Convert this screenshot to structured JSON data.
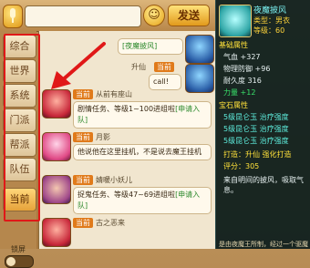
{
  "input": {
    "send_label": "发送",
    "emoji_label": "☺"
  },
  "tabs": [
    {
      "label": "综合"
    },
    {
      "label": "世界"
    },
    {
      "label": "系统"
    },
    {
      "label": "门派"
    },
    {
      "label": "帮派"
    },
    {
      "label": "队伍"
    },
    {
      "label": "当前"
    }
  ],
  "lock_label": "锁屏",
  "messages": [
    {
      "tag": "",
      "name": "",
      "text_prefix": "",
      "text_link": "[夜魔披风]",
      "text_suffix": ""
    },
    {
      "tag": "当前",
      "name": "升仙",
      "text_prefix": "call!",
      "text_link": "",
      "text_suffix": ""
    },
    {
      "tag": "当前",
      "name": "从前有座山",
      "text_prefix": "剧情任务、等级1~100进组啦",
      "text_link": "[申请入队]",
      "text_suffix": ""
    },
    {
      "tag": "当前",
      "name": "月影",
      "text_prefix": "他说他在这里挂机，不是说去魔王挂机",
      "text_link": "",
      "text_suffix": ""
    },
    {
      "tag": "当前",
      "name": "婧暖小妖儿",
      "text_prefix": "捉鬼任务、等级47~69进组啦",
      "text_link": "[申请入队]",
      "text_suffix": ""
    },
    {
      "tag": "当前",
      "name": "古之恶来",
      "text_prefix": "",
      "text_link": "",
      "text_suffix": ""
    }
  ],
  "tooltip": {
    "title": "夜魔披风",
    "type_line": "类型：男衣",
    "level_line": "等级：60",
    "base_section": "基础属性",
    "stats": [
      "气血 +327",
      "物理防御 +96",
      "耐久度 316"
    ],
    "power": "力量 +12",
    "gem_section": "宝石属性",
    "gems": [
      "5级昆仑玉 治疗强度",
      "5级昆仑玉 治疗强度",
      "5级昆仑玉 治疗强度"
    ],
    "forge": "打造：升仙   强化打造",
    "score": "评分：305",
    "desc": "来自明间的披风，吸取气息。"
  },
  "bottom_text": "是由夜魔王所制，经过一个驱魔"
}
